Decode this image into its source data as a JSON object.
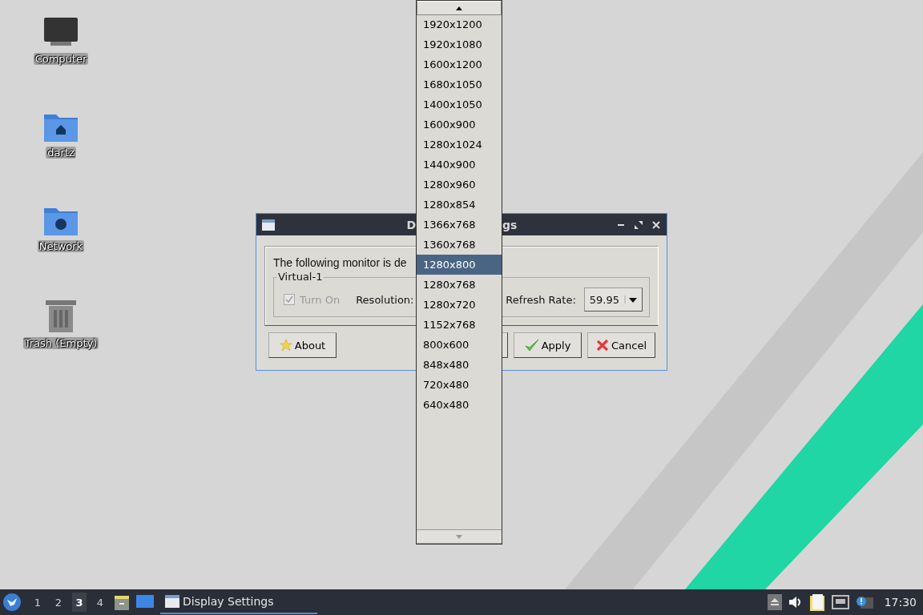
{
  "desktop_icons": [
    {
      "kind": "computer",
      "label": "Computer"
    },
    {
      "kind": "home",
      "label": "dartz"
    },
    {
      "kind": "network",
      "label": "Network"
    },
    {
      "kind": "trash",
      "label": "Trash (Empty)"
    }
  ],
  "dialog": {
    "title_start": "D",
    "title_end": "gs",
    "message": "The following monitor is de",
    "monitor": {
      "name": "Virtual-1",
      "turn_on": {
        "label": "Turn On",
        "checked": true,
        "disabled": true
      },
      "resolution_label": "Resolution:",
      "refresh_label": "Refresh Rate:",
      "refresh_value": "59.95"
    },
    "buttons": [
      {
        "kind": "about",
        "label": "About"
      },
      {
        "kind": "partial"
      },
      {
        "kind": "apply",
        "label": "Apply"
      },
      {
        "kind": "cancel",
        "label": "Cancel"
      }
    ]
  },
  "resolution_popup": {
    "items": [
      {
        "label": "1920x1200",
        "selected": false
      },
      {
        "label": "1920x1080",
        "selected": false
      },
      {
        "label": "1600x1200",
        "selected": false
      },
      {
        "label": "1680x1050",
        "selected": false
      },
      {
        "label": "1400x1050",
        "selected": false
      },
      {
        "label": "1600x900",
        "selected": false
      },
      {
        "label": "1280x1024",
        "selected": false
      },
      {
        "label": "1440x900",
        "selected": false
      },
      {
        "label": "1280x960",
        "selected": false
      },
      {
        "label": "1280x854",
        "selected": false
      },
      {
        "label": "1366x768",
        "selected": false
      },
      {
        "label": "1360x768",
        "selected": false
      },
      {
        "label": "1280x800",
        "selected": true
      },
      {
        "label": "1280x768",
        "selected": false
      },
      {
        "label": "1280x720",
        "selected": false
      },
      {
        "label": "1152x768",
        "selected": false
      },
      {
        "label": "800x600",
        "selected": false
      },
      {
        "label": "848x480",
        "selected": false
      },
      {
        "label": "720x480",
        "selected": false
      },
      {
        "label": "640x480",
        "selected": false
      }
    ]
  },
  "taskbar": {
    "workspaces": [
      {
        "label": "1",
        "selected": false
      },
      {
        "label": "2",
        "selected": false
      },
      {
        "label": "3",
        "selected": true
      },
      {
        "label": "4",
        "selected": false
      }
    ],
    "tasks": [
      {
        "label": "Display Settings",
        "selected": true
      }
    ],
    "clock": "17:30"
  }
}
